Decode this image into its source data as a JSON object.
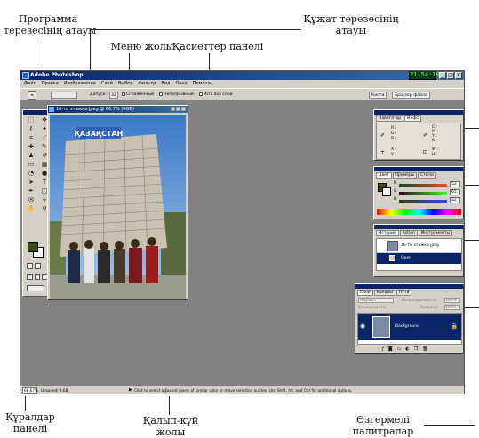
{
  "captions": {
    "program_title": [
      "Программа",
      "терезесінің атауы"
    ],
    "document_title": [
      "Құжат терезесінің",
      "атауы"
    ],
    "menu_bar": "Меню жолы",
    "options_bar": "Қасиеттер  панелі",
    "tools_panel": [
      "Құралдар",
      "панелі"
    ],
    "status_bar": [
      "Қалып-күй",
      "жолы"
    ],
    "floating_palettes": [
      "Өзгермелі",
      "палитралар"
    ]
  },
  "app": {
    "title": "Adobe Photoshop",
    "clock": "21:54:10",
    "window_buttons": [
      "_",
      "□",
      "×"
    ]
  },
  "menu": [
    "Файл",
    "Правка",
    "Изображение",
    "Слой",
    "Выбор",
    "Фильтр",
    "Вид",
    "Окно",
    "Помощь"
  ],
  "options": {
    "feather_label": "Допуск:",
    "feather_value": "32",
    "antialias": "Сглаженный",
    "contiguous": "Непрерывный",
    "all_layers": "Исп. все слои",
    "tab_brushes": "Кисти",
    "tab_files": "Браузер файла"
  },
  "document": {
    "title": "16-ти этажка.jpeg @ 66,7% (RGB)",
    "sign_text": "ҚАЗАҚСТАН"
  },
  "navigator": {
    "tabs": [
      "Навигатор",
      "Инфо"
    ],
    "rows": [
      {
        "left": "R :",
        "l2": "G :",
        "l3": "B :",
        "right": "C :",
        "r2": "M :",
        "r3": "Y :",
        "r4": "K :"
      },
      {
        "left": "X :",
        "l2": "Y :",
        "right": "W :",
        "r2": "H :"
      }
    ]
  },
  "color": {
    "tabs": [
      "Цвет",
      "Примеры",
      "Стили"
    ],
    "channels": [
      {
        "label": "R",
        "value": "52"
      },
      {
        "label": "G",
        "value": "65"
      },
      {
        "label": "B",
        "value": "32"
      }
    ]
  },
  "history": {
    "tabs": [
      "История",
      "Action",
      "Инструменты"
    ],
    "items": [
      "16-ти этажка.jpeg",
      "Open"
    ]
  },
  "layers": {
    "tabs": [
      "Слой",
      "Каналы",
      "Пути"
    ],
    "blend_mode": "Нормал",
    "opacity_label": "Непрозрачность:",
    "opacity_value": "100%",
    "lock_label": "Блокировать:",
    "fill_label": "Заливка:",
    "fill_value": "100%",
    "layer_name": "Background"
  },
  "status": {
    "zoom": "66,67%",
    "file": "Unsaved/ 9.6B",
    "hint": "Click to select adjacent pixels of similar color or move selection outline.  Use Shift, Alt, and Ctrl for additional options."
  },
  "colors": {
    "workspace": "#828282",
    "chrome": "#d4d0c8",
    "titlebar": "#0a246a",
    "selection": "#0a246a",
    "foreground_swatch": "#3a4a1a"
  }
}
